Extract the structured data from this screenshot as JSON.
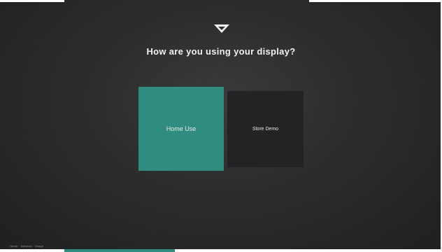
{
  "header": {
    "logo_icon": "vizio-v-logo-icon",
    "title": "How are you using your display?"
  },
  "options": {
    "home_label": "Home Use",
    "store_label": "Store Demo"
  },
  "footer": {
    "breadcrumb": "Home · Network · Usage",
    "progress_fraction": 0.25
  },
  "colors": {
    "accent": "#2f8c7e",
    "background": "#2c2c2c",
    "card_dark": "#232325"
  }
}
